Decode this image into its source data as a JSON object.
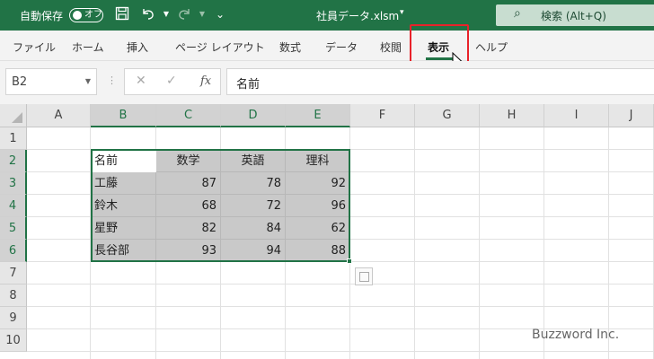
{
  "titlebar": {
    "autosave_label": "自動保存",
    "autosave_state": "オフ",
    "file_name": "社員データ.xlsm",
    "search_label": "検索 (Alt+Q)"
  },
  "ribbon": {
    "tabs": [
      {
        "label": "ファイル"
      },
      {
        "label": "ホーム"
      },
      {
        "label": "挿入"
      },
      {
        "label": "ページ レイアウト"
      },
      {
        "label": "数式"
      },
      {
        "label": "データ"
      },
      {
        "label": "校閲"
      },
      {
        "label": "表示",
        "active": true
      },
      {
        "label": "ヘルプ"
      }
    ]
  },
  "formula_bar": {
    "name_box": "B2",
    "fx_label": "fx",
    "value": "名前"
  },
  "sheet": {
    "columns": [
      "A",
      "B",
      "C",
      "D",
      "E",
      "F",
      "G",
      "H",
      "I",
      "J"
    ],
    "rows": [
      "1",
      "2",
      "3",
      "4",
      "5",
      "6",
      "7",
      "8",
      "9",
      "10"
    ],
    "table": {
      "header": [
        "名前",
        "数学",
        "英語",
        "理科"
      ],
      "rows": [
        [
          "工藤",
          "87",
          "78",
          "92"
        ],
        [
          "鈴木",
          "68",
          "72",
          "96"
        ],
        [
          "星野",
          "82",
          "84",
          "62"
        ],
        [
          "長谷部",
          "93",
          "94",
          "88"
        ]
      ]
    }
  },
  "watermark": "Buzzword Inc.",
  "colors": {
    "accent": "#217346",
    "highlight": "#e8222a",
    "selection_fill": "#c9c9c9"
  }
}
